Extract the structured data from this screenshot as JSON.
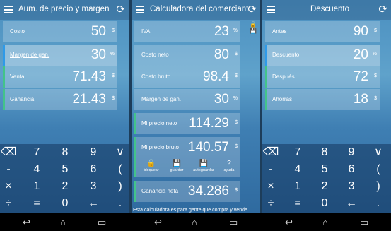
{
  "colors": {
    "green": "#43c38a",
    "blue": "#2f9ae8"
  },
  "panel1": {
    "title": "Aum. de precio y margen de ...",
    "rows": [
      {
        "label": "Costo",
        "value": "50",
        "unit": "$"
      },
      {
        "label": "Margen de gan.",
        "value": "30",
        "unit": "%"
      },
      {
        "label": "Venta",
        "value": "71.43",
        "unit": "$"
      },
      {
        "label": "Ganancia",
        "value": "21.43",
        "unit": "$"
      }
    ]
  },
  "panel2": {
    "title": "Calculadora del comerciante ...",
    "rows": [
      {
        "label": "IVA",
        "value": "23",
        "unit": "%"
      },
      {
        "label": "Costo neto",
        "value": "80",
        "unit": "$"
      },
      {
        "label": "Costo bruto",
        "value": "98.4",
        "unit": "$"
      },
      {
        "label": "Margen de gan.",
        "value": "30",
        "unit": "%"
      },
      {
        "label": "Mi precio neto",
        "value": "114.29",
        "unit": "$"
      },
      {
        "label": "Mi precio bruto",
        "value": "140.57",
        "unit": "$"
      },
      {
        "label": "Ganancia neta",
        "value": "34.286",
        "unit": "$"
      }
    ],
    "toolbar": [
      "bloquear",
      "guardar",
      "autoguardar",
      "ayuda"
    ],
    "note": "Esta calculadora es para gente que compra y vende"
  },
  "panel3": {
    "title": "Descuento",
    "rows": [
      {
        "label": "Antes",
        "value": "90",
        "unit": "$"
      },
      {
        "label": "Descuento",
        "value": "20",
        "unit": "%"
      },
      {
        "label": "Después",
        "value": "72",
        "unit": "$"
      },
      {
        "label": "Ahorras",
        "value": "18",
        "unit": "$"
      }
    ]
  },
  "keys": [
    [
      "⌫",
      "7",
      "8",
      "9",
      "∨"
    ],
    [
      "-",
      "4",
      "5",
      "6",
      "("
    ],
    [
      "×",
      "1",
      "2",
      "3",
      ")"
    ],
    [
      "÷",
      "=",
      "0",
      "←",
      "."
    ]
  ],
  "icons": {
    "menu": "menu-icon",
    "refresh": "refresh-icon",
    "lock": "lock-icon",
    "save": "save-icon",
    "help": "help-icon"
  },
  "nav": [
    "↩",
    "⌂",
    "▭"
  ]
}
